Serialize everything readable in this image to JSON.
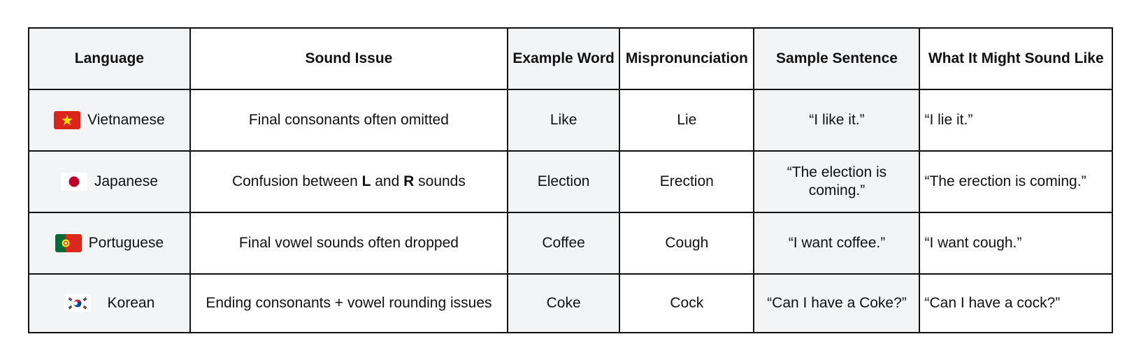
{
  "table": {
    "headers": [
      "Language",
      "Sound Issue",
      "Example Word",
      "Mispronunciation",
      "Sample Sentence",
      "What It Might Sound Like"
    ],
    "rows": [
      {
        "flag_icon": "vietnam-flag-icon",
        "language": "Vietnamese",
        "issue": "Final consonants often omitted",
        "example": "Like",
        "mispronunciation": "Lie",
        "sentence": "“I like it.”",
        "sounds_like": "“I lie it.”"
      },
      {
        "flag_icon": "japan-flag-icon",
        "language": "Japanese",
        "issue_pre": "Confusion between ",
        "issue_b1": "L",
        "issue_mid": " and ",
        "issue_b2": "R",
        "issue_post": " sounds",
        "example": "Election",
        "mispronunciation": "Erection",
        "sentence": "“The election is coming.”",
        "sounds_like": "“The erection is coming.”"
      },
      {
        "flag_icon": "portugal-flag-icon",
        "language": "Portuguese",
        "issue": "Final vowel sounds often dropped",
        "example": "Coffee",
        "mispronunciation": "Cough",
        "sentence": "“I want coffee.”",
        "sounds_like": "“I want cough.”"
      },
      {
        "flag_icon": "korea-flag-icon",
        "language": "Korean",
        "issue": "Ending consonants + vowel rounding issues",
        "example": "Coke",
        "mispronunciation": "Cock",
        "sentence": "“Can I have a Coke?”",
        "sounds_like": "“Can I have a cock?”"
      }
    ]
  },
  "colors": {
    "shade": "#f3f4f6",
    "border": "#111111",
    "vietnam_red": "#da251d",
    "vietnam_star": "#ffde00",
    "japan_red": "#bc002d",
    "portugal_green": "#046a38",
    "portugal_red": "#da291c"
  }
}
